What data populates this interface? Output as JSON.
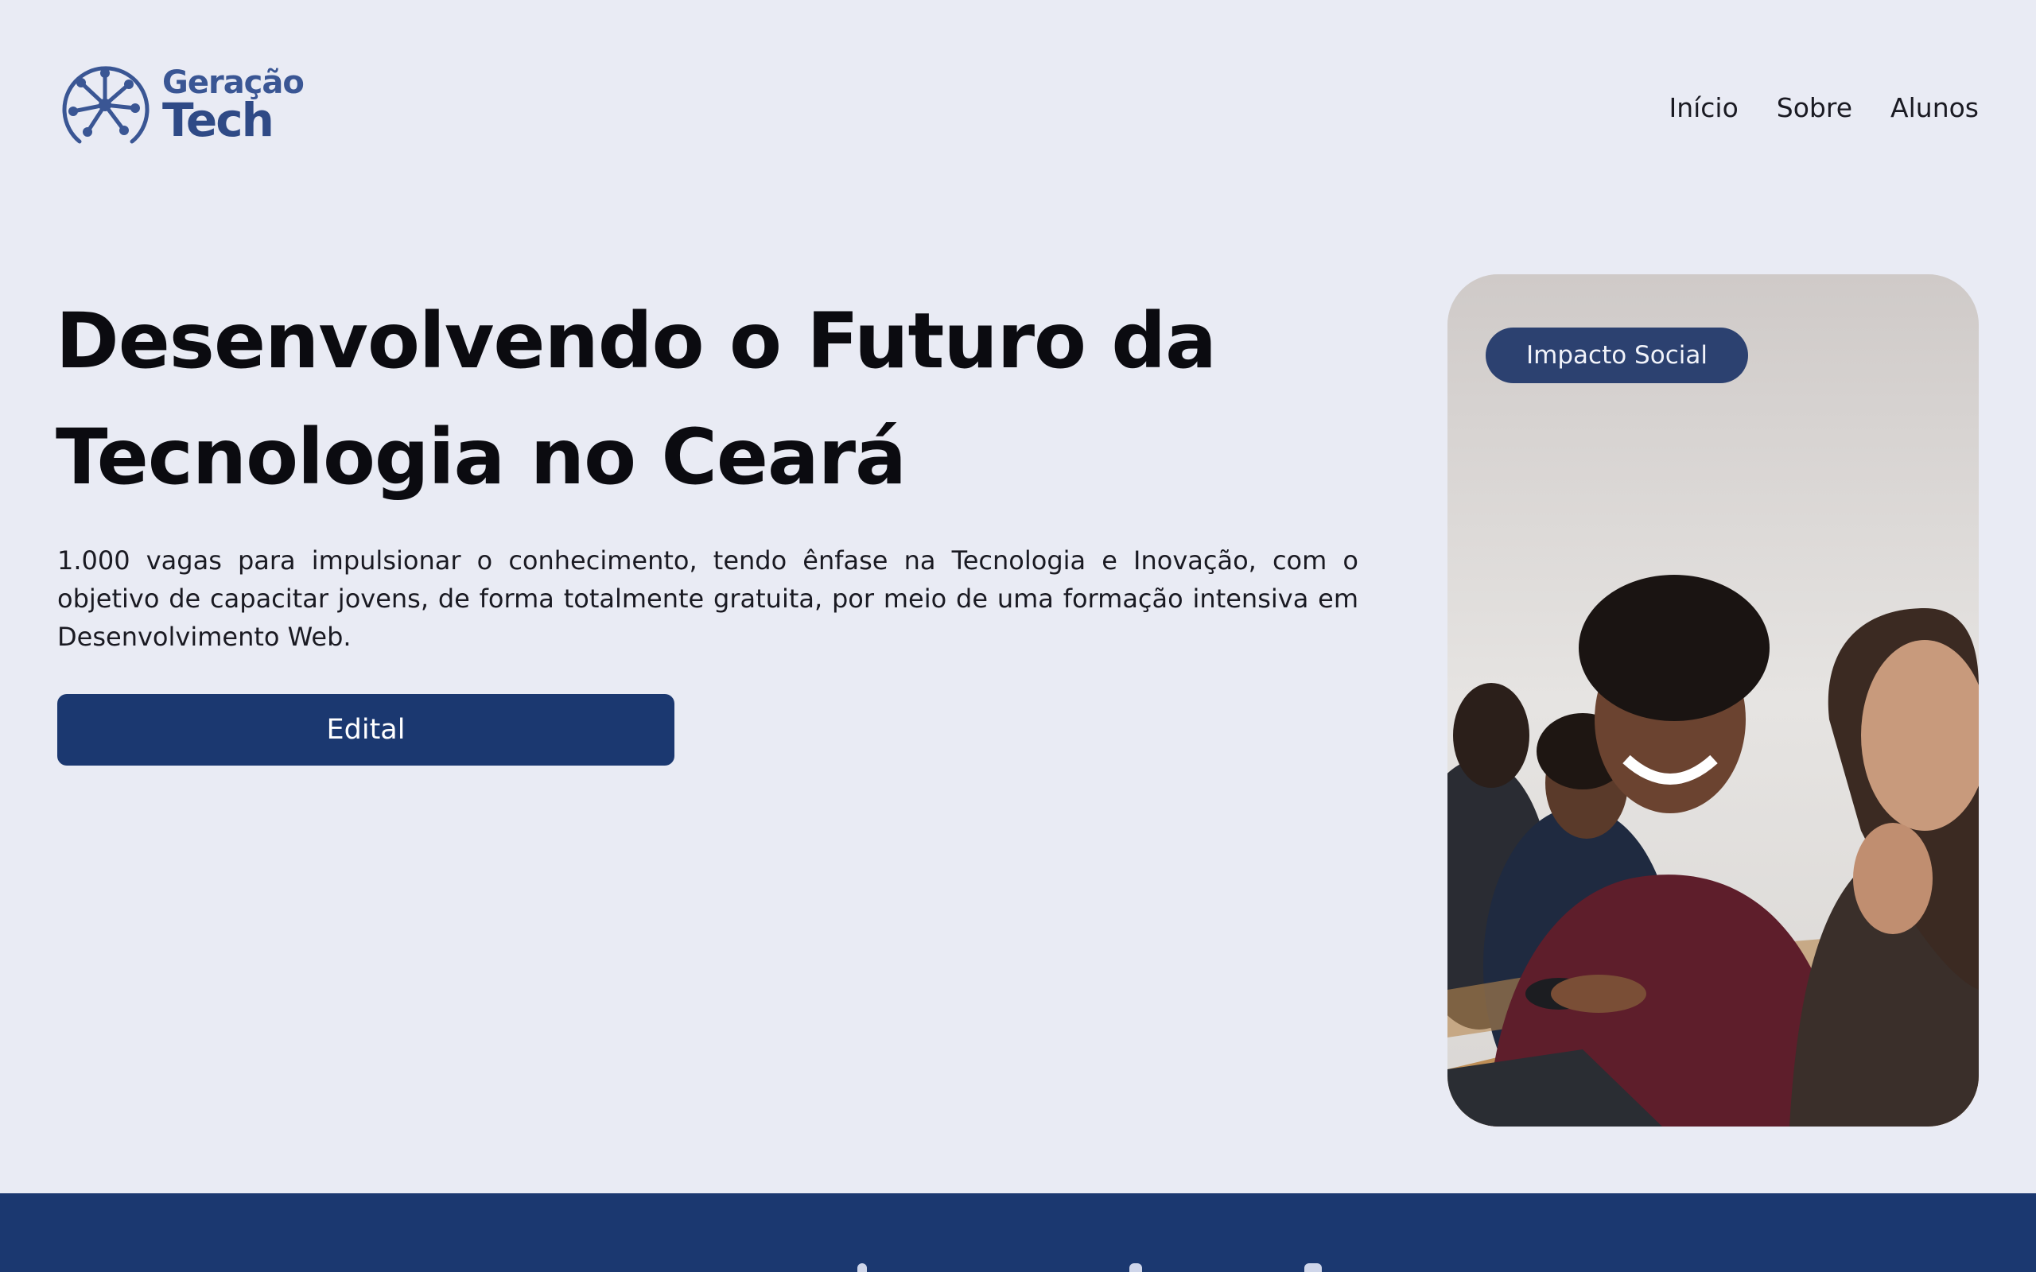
{
  "header": {
    "logo_top": "Geração",
    "logo_bottom": "Tech",
    "nav": [
      "Início",
      "Sobre",
      "Alunos"
    ]
  },
  "hero": {
    "title_line1": "Desenvolvendo o Futuro da",
    "title_line2": "Tecnologia no Ceará",
    "description": "1.000 vagas para impulsionar o conhecimento, tendo ênfase na Tecnologia e Inovação, com o objetivo de capacitar jovens, de forma totalmente gratuita, por meio de uma formação intensiva em Desenvolvimento Web.",
    "button_label": "Edital"
  },
  "photo": {
    "badge": "Impacto Social"
  },
  "colors": {
    "background": "#e9ebf4",
    "primary": "#1b3870",
    "logo": "#3a5694",
    "badge": "#2c4170"
  }
}
